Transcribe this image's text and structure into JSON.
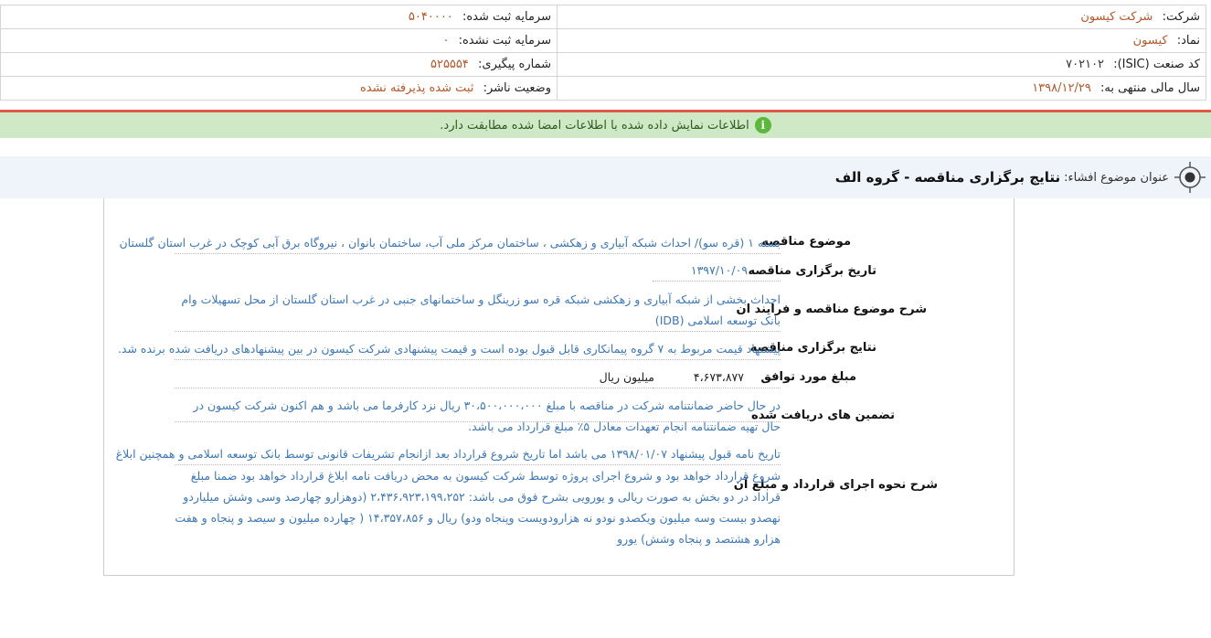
{
  "header": {
    "company_label": "شرکت:",
    "company_value": "شرکت کیسون",
    "registered_capital_label": "سرمایه ثبت شده:",
    "registered_capital_value": "۵۰۴۰۰۰۰",
    "symbol_label": "نماد:",
    "symbol_value": "کیسون",
    "unregistered_capital_label": "سرمایه ثبت نشده:",
    "unregistered_capital_value": "۰",
    "isic_label": "کد صنعت (ISIC):",
    "isic_value": "۷۰۲۱۰۲",
    "tracking_label": "شماره پیگیری:",
    "tracking_value": "۵۲۵۵۵۴",
    "fiscal_label": "سال مالی منتهی به:",
    "fiscal_value": "۱۳۹۸/۱۲/۲۹",
    "publisher_status_label": "وضعیت ناشر:",
    "publisher_status_value": "ثبت شده پذیرفته نشده"
  },
  "notice": {
    "icon": "info-icon",
    "text": "اطلاعات نمایش داده شده با اطلاعات امضا شده مطابقت دارد."
  },
  "subject": {
    "label": "عنوان موضوع افشاء:",
    "title": "نتایج برگزاری مناقصه - گروه الف"
  },
  "details": {
    "subject_label": "موضوع مناقصه",
    "subject_value": "بسته ۱ (قره سو)/ احداث شبکه آبیاری و زهکشی ، ساختمان مرکز ملی آب، ساختمان بانوان ، نیروگاه برق آبی کوچک در غرب استان گلستان",
    "date_label": "تاریخ برگزاری مناقصه",
    "date_value": "۱۳۹۷/۱۰/۰۹",
    "description_label": "شرح موضوع مناقصه و فرایند ان",
    "description_value": "احداث بخشی از شبکه آبیاری و زهکشی شبکه قره سو زرینگل و ساختمانهای جنبی در غرب استان گلستان از محل تسهیلات وام بانک توسعه اسلامی (IDB)",
    "result_label": "نتایج برگزاری مناقصه",
    "result_value": "پیشنهاد قیمت مربوط به ۷ گروه پیمانکاری قابل قبول بوده است و قیمت پیشنهادی شرکت کیسون در بین پیشنهادهای دریافت شده برنده شد.",
    "amount_label": "مبلغ مورد توافق",
    "amount_value": "۴،۶۷۳،۸۷۷",
    "amount_unit": "میلیون ریال",
    "guarantee_label": "تضمین های دریافت شده",
    "guarantee_value": "در حال حاضر ضمانتنامه شرکت در مناقصه با مبلغ ۳۰،۵۰۰،۰۰۰،۰۰۰ ریال نزد کارفرما می باشد و هم اکنون شرکت کیسون در حال تهیه ضمانتنامه انجام تعهدات معادل ۵٪ مبلغ قرارداد می باشد.",
    "contract_label": "شرح نحوه اجرای قرارداد و مبلغ آن",
    "contract_value_1": "تاریخ نامه قبول پیشنهاد ۱۳۹۸/۰۱/۰۷ می باشد اما تاریخ شروع قرارداد بعد ازانجام تشریفات قانونی توسط بانک توسعه اسلامی و همچنین ابلاغ",
    "contract_value_2": "شروع قرارداد خواهد بود و شروع اجرای پروژه توسط شرکت کیسون به محض دریافت نامه ابلاغ قرارداد خواهد بود ضمنا مبلغ قراداد در دو بخش به صورت ریالی و یورویی بشرح فوق می باشد: ۲،۴۳۶،۹۲۳،۱۹۹،۲۵۲ (دوهزارو چهارصد وسی وشش میلیاردو نهصدو بیست وسه میلیون ویکصدو نودو نه هزارودویست وپنجاه ودو) ریال و ۱۴،۳۵۷،۸۵۶ ( چهارده میلیون و سیصد و پنجاه و هفت هزارو هشتصد و پنجاه وشش) یورو"
  }
}
